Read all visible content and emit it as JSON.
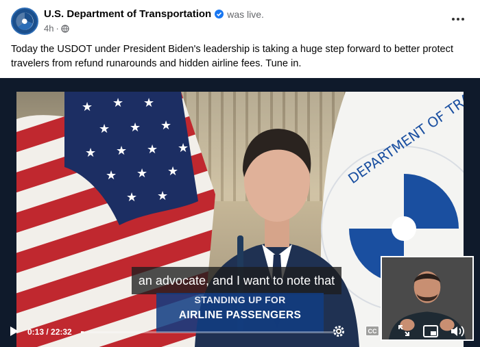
{
  "post": {
    "author": "U.S. Department of Transportation",
    "status": "was live.",
    "time_ago": "4h",
    "separator": "·",
    "body": "Today the USDOT under President Biden's leadership is taking a huge step forward to better protect travelers from refund runarounds and hidden airline fees. Tune in."
  },
  "icons": {
    "avatar": "dot-logo-icon",
    "verified": "verified-badge-icon",
    "privacy": "globe-icon",
    "more": "more-options-icon"
  },
  "video": {
    "caption": "an advocate, and I want to note that",
    "lower_third_line1": "STANDING UP FOR",
    "lower_third_line2": "AIRLINE PASSENGERS",
    "flag_text": "DEPARTMENT OF TRA",
    "time_display": "0:13 / 22:32",
    "cc_label": "CC",
    "progress_fraction": 0.0096
  },
  "colors": {
    "accent_blue": "#1877f2",
    "dot_blue": "#1b4f8c",
    "lower_third": "#123c82"
  }
}
